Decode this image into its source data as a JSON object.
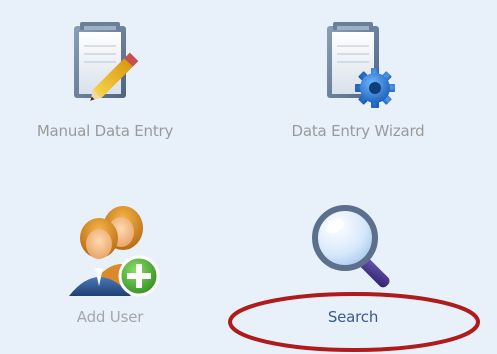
{
  "tiles": {
    "manual_data_entry": {
      "label": "Manual Data Entry",
      "icon": "clipboard-pencil-icon"
    },
    "data_entry_wizard": {
      "label": "Data Entry Wizard",
      "icon": "clipboard-gear-icon"
    },
    "add_user": {
      "label": "Add User",
      "icon": "add-user-icon"
    },
    "search": {
      "label": "Search",
      "icon": "magnifier-icon"
    }
  },
  "colors": {
    "panel_background": "#e8f1fa",
    "highlight_ring": "#b01a1a",
    "search_label": "#3a5a8c",
    "disabled_label": "#9a9a9a"
  }
}
